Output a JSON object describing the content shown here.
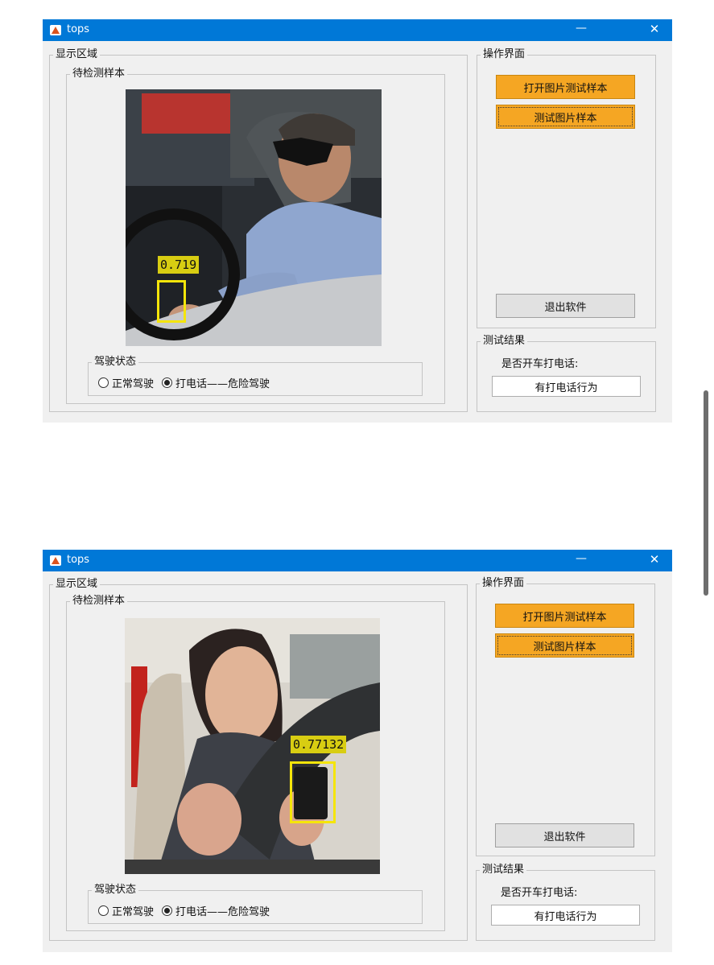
{
  "windows": [
    {
      "title": "tops",
      "title_buttons": {
        "minimize": "—",
        "close": "✕"
      },
      "display_area": {
        "label": "显示区域",
        "sample_panel_label": "待检测样本",
        "detection": {
          "score": "0.719"
        },
        "driving_state": {
          "label": "驾驶状态",
          "options": [
            "正常驾驶",
            "打电话——危险驾驶"
          ],
          "selected_index": 1
        }
      },
      "operation_panel": {
        "label": "操作界面",
        "open_button": "打开图片测试样本",
        "test_button": "测试图片样本",
        "exit_button": "退出软件"
      },
      "results": {
        "label": "测试结果",
        "question": "是否开车打电话:",
        "answer": "有打电话行为"
      }
    },
    {
      "title": "tops",
      "title_buttons": {
        "minimize": "—",
        "close": "✕"
      },
      "display_area": {
        "label": "显示区域",
        "sample_panel_label": "待检测样本",
        "detection": {
          "score": "0.77132"
        },
        "driving_state": {
          "label": "驾驶状态",
          "options": [
            "正常驾驶",
            "打电话——危险驾驶"
          ],
          "selected_index": 1
        }
      },
      "operation_panel": {
        "label": "操作界面",
        "open_button": "打开图片测试样本",
        "test_button": "测试图片样本",
        "exit_button": "退出软件"
      },
      "results": {
        "label": "测试结果",
        "question": "是否开车打电话:",
        "answer": "有打电话行为"
      }
    }
  ],
  "colors": {
    "titlebar": "#0078d7",
    "action_button": "#f5a623",
    "detection_box": "#f5e50a",
    "window_bg": "#f0f0f0"
  }
}
